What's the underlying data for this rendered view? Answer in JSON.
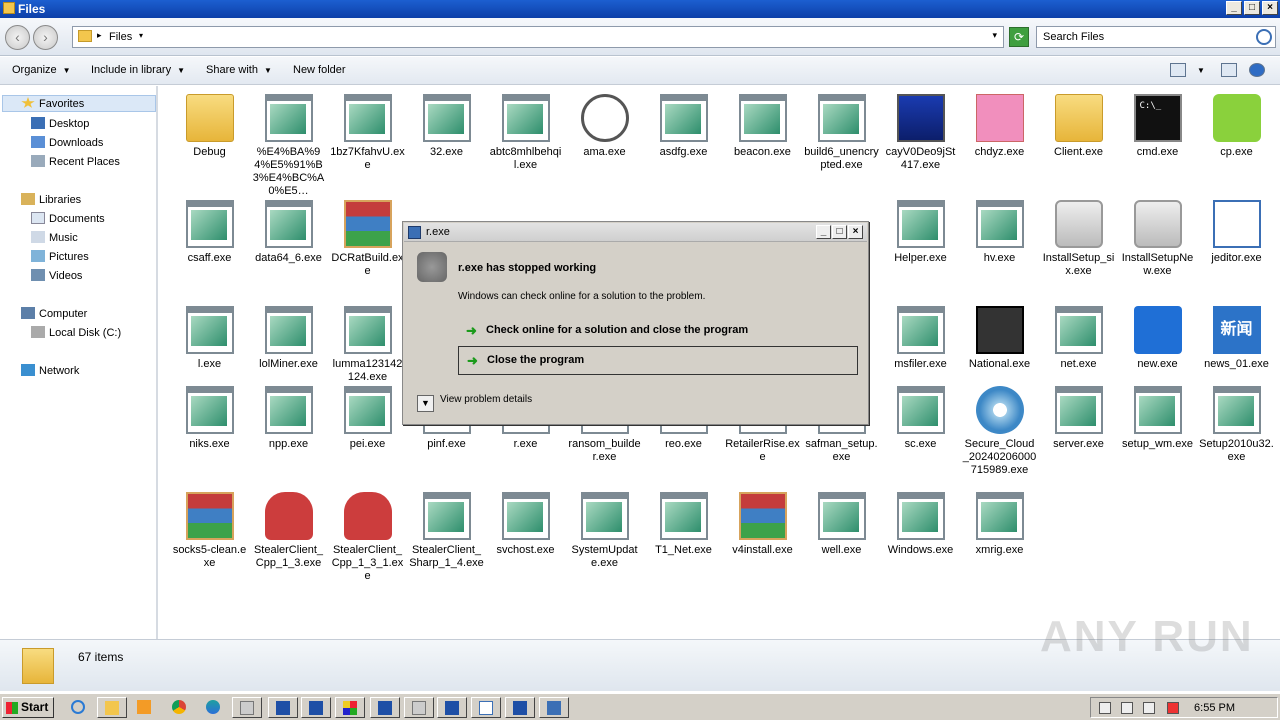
{
  "window": {
    "title": "Files"
  },
  "address": {
    "path": "Files",
    "search_placeholder": "Search Files"
  },
  "toolbar": {
    "organize": "Organize",
    "include": "Include in library",
    "share": "Share with",
    "new_folder": "New folder"
  },
  "sidebar": {
    "favorites": "Favorites",
    "desktop": "Desktop",
    "downloads": "Downloads",
    "recent": "Recent Places",
    "libraries": "Libraries",
    "documents": "Documents",
    "music": "Music",
    "pictures": "Pictures",
    "videos": "Videos",
    "computer": "Computer",
    "localdisk": "Local Disk (C:)",
    "network": "Network"
  },
  "files": [
    "Debug",
    "%E4%BA%94%E5%91%B3%E4%BC%A0%E5…",
    "1bz7KfahvU.exe",
    "32.exe",
    "abtc8mhlbehqil.exe",
    "ama.exe",
    "asdfg.exe",
    "beacon.exe",
    "build6_unencrypted.exe",
    "cayV0Deo9jSt417.exe",
    "chdyz.exe",
    "Client.exe",
    "cmd.exe",
    "cp.exe",
    "csaff.exe",
    "data64_6.exe",
    "DCRatBuild.exe",
    "",
    "",
    "",
    "",
    "",
    "",
    "",
    "Helper.exe",
    "hv.exe",
    "InstallSetup_six.exe",
    "InstallSetupNew.exe",
    "jeditor.exe",
    "l.exe",
    "lolMiner.exe",
    "lumma123142124.exe",
    "",
    "",
    "",
    "",
    "",
    "",
    "msfiler.exe",
    "National.exe",
    "net.exe",
    "new.exe",
    "news_01.exe",
    "niks.exe",
    "npp.exe",
    "pei.exe",
    "pinf.exe",
    "r.exe",
    "ransom_builder.exe",
    "reo.exe",
    "RetailerRise.exe",
    "safman_setup.exe",
    "sc.exe",
    "Secure_Cloud_20240206000715989.exe",
    "server.exe",
    "setup_wm.exe",
    "Setup2010u32.exe",
    "socks5-clean.exe",
    "StealerClient_Cpp_1_3.exe",
    "StealerClient_Cpp_1_3_1.exe",
    "StealerClient_Sharp_1_4.exe",
    "svchost.exe",
    "SystemUpdate.exe",
    "T1_Net.exe",
    "v4install.exe",
    "well.exe",
    "Windows.exe",
    "xmrig.exe"
  ],
  "status": {
    "count": "67 items"
  },
  "watermark": "ANY RUN",
  "dialog": {
    "title": "r.exe",
    "heading": "r.exe has stopped working",
    "subtext": "Windows can check online for a solution to the problem.",
    "option1": "Check online for a solution and close the program",
    "option2": "Close the program",
    "details": "View problem details"
  },
  "taskbar": {
    "start": "Start",
    "clock": "6:55 PM"
  }
}
